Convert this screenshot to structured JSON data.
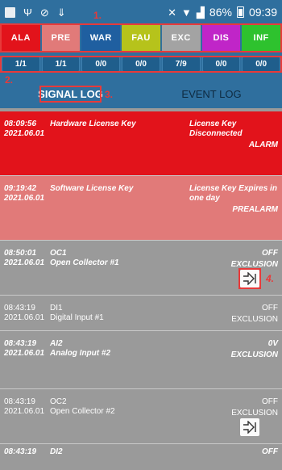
{
  "status_bar": {
    "battery_percent": "86%",
    "time": "09:39",
    "icons": [
      "notification-square-icon",
      "usb-icon",
      "sync-icon",
      "download-icon",
      "mute-icon",
      "wifi-icon",
      "signal-icon",
      "battery-icon"
    ]
  },
  "categories": [
    {
      "label": "ALA",
      "color": "#e2131b"
    },
    {
      "label": "PRE",
      "color": "#e17a79"
    },
    {
      "label": "WAR",
      "color": "#1f5fa0"
    },
    {
      "label": "FAU",
      "color": "#b6c31b"
    },
    {
      "label": "EXC",
      "color": "#a3a3a3"
    },
    {
      "label": "DIS",
      "color": "#c025c8"
    },
    {
      "label": "INF",
      "color": "#2ec22e"
    }
  ],
  "counts": [
    "1/1",
    "1/1",
    "0/0",
    "0/0",
    "7/9",
    "0/0",
    "0/0"
  ],
  "tabs": {
    "signal_log": "SIGNAL LOG",
    "event_log": "EVENT LOG"
  },
  "annotations": [
    "1.",
    "2.",
    "3.",
    "4."
  ],
  "events": [
    {
      "time": "08:09:56",
      "date": "2021.06.01",
      "name": "Hardware License Key",
      "name2": "",
      "status": "License Key Disconnected",
      "severity": "ALARM",
      "style": "alarm"
    },
    {
      "time": "09:19:42",
      "date": "2021.06.01",
      "name": "Software License Key",
      "name2": "",
      "status": "License Key Expires in one day",
      "severity": "PREALARM",
      "style": "prealarm"
    },
    {
      "time": "08:50:01",
      "date": "2021.06.01",
      "name": "OC1",
      "name2": "Open Collector #1",
      "status": "OFF",
      "severity": "EXCLUSION",
      "style": "grey-bi"
    },
    {
      "time": "08:43:19",
      "date": "2021.06.01",
      "name": "DI1",
      "name2": "Digital Input #1",
      "status": "OFF",
      "severity": "EXCLUSION",
      "style": "grey"
    },
    {
      "time": "08:43:19",
      "date": "2021.06.01",
      "name": "AI2",
      "name2": "Analog Input #2",
      "status": "0V",
      "severity": "EXCLUSION",
      "style": "grey-bi"
    },
    {
      "time": "08:43:19",
      "date": "2021.06.01",
      "name": "OC2",
      "name2": "Open Collector #2",
      "status": "OFF",
      "severity": "EXCLUSION",
      "style": "grey"
    },
    {
      "time": "08:43:19",
      "date": "",
      "name": "DI2",
      "name2": "",
      "status": "OFF",
      "severity": "",
      "style": "grey-bi"
    }
  ]
}
